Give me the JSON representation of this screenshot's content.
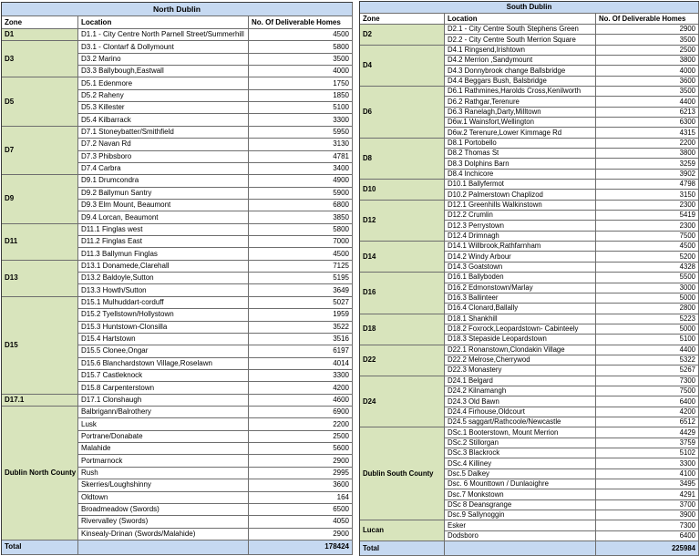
{
  "colors": {
    "title_bg": "#c6d9f1",
    "zone_bg": "#d8e4bc",
    "total_bg": "#c6d9f1",
    "grid_line": "#6e6e6e"
  },
  "north": {
    "title": "North Dublin",
    "headers": {
      "zone": "Zone",
      "location": "Location",
      "homes": "No. Of Deliverable Homes"
    },
    "zones": [
      {
        "zone": "D1",
        "rows": [
          {
            "location": "D1.1 - City Centre North Parnell Street/Summerhill",
            "homes": 4500
          }
        ]
      },
      {
        "zone": "D3",
        "rows": [
          {
            "location": "D3.1 - Clontarf & Dollymount",
            "homes": 5800
          },
          {
            "location": "D3.2 Marino",
            "homes": 3500
          },
          {
            "location": "D3.3 Ballybough,Eastwall",
            "homes": 4000
          }
        ]
      },
      {
        "zone": "D5",
        "rows": [
          {
            "location": "D5.1 Edenmore",
            "homes": 1750
          },
          {
            "location": "D5.2 Raheny",
            "homes": 1850
          },
          {
            "location": "D5.3 Killester",
            "homes": 5100
          },
          {
            "location": "D5.4 Kilbarrack",
            "homes": 3300
          }
        ]
      },
      {
        "zone": "D7",
        "rows": [
          {
            "location": "D7.1 Stoneybatter/Smithfield",
            "homes": 5950
          },
          {
            "location": "D7.2 Navan Rd",
            "homes": 3130
          },
          {
            "location": "D7.3 Phibsboro",
            "homes": 4781
          },
          {
            "location": "D7.4 Carbra",
            "homes": 3400
          }
        ]
      },
      {
        "zone": "D9",
        "rows": [
          {
            "location": "D9.1 Drumcondra",
            "homes": 4900
          },
          {
            "location": "D9.2 Ballymun Santry",
            "homes": 5900
          },
          {
            "location": "D9.3 Elm Mount, Beaumont",
            "homes": 6800
          },
          {
            "location": "D9.4 Lorcan, Beaumont",
            "homes": 3850
          }
        ]
      },
      {
        "zone": "D11",
        "rows": [
          {
            "location": "D11.1 Finglas west",
            "homes": 5800
          },
          {
            "location": "D11.2 Finglas East",
            "homes": 7000
          },
          {
            "location": "D11.3 Ballymun Finglas",
            "homes": 4500
          }
        ]
      },
      {
        "zone": "D13",
        "rows": [
          {
            "location": "D13.1 Donamede,Clarehall",
            "homes": 7125
          },
          {
            "location": "D13.2 Baldoyle,Sutton",
            "homes": 5195
          },
          {
            "location": "D13.3 Howth/Sutton",
            "homes": 3649
          }
        ]
      },
      {
        "zone": "D15",
        "rows": [
          {
            "location": "D15.1 Mulhuddart-corduff",
            "homes": 5027
          },
          {
            "location": "D15.2 Tyellstown/Hollystown",
            "homes": 1959
          },
          {
            "location": "D15.3 Huntstown-Clonsilla",
            "homes": 3522
          },
          {
            "location": "D15.4 Hartstown",
            "homes": 3516
          },
          {
            "location": "D15.5 Clonee,Ongar",
            "homes": 6197
          },
          {
            "location": "D15.6 Blanchardstown Village,Roselawn",
            "homes": 4014
          },
          {
            "location": "D15.7 Castleknock",
            "homes": 3300
          },
          {
            "location": "D15.8 Carpenterstown",
            "homes": 4200
          }
        ]
      },
      {
        "zone": "D17.1",
        "rows": [
          {
            "location": "D17.1 Clonshaugh",
            "homes": 4600
          }
        ]
      },
      {
        "zone": "Dublin North County",
        "rows": [
          {
            "location": "Balbrigann/Balrothery",
            "homes": 6900
          },
          {
            "location": "Lusk",
            "homes": 2200
          },
          {
            "location": "Portrane/Donabate",
            "homes": 2500
          },
          {
            "location": "Malahide",
            "homes": 5600
          },
          {
            "location": "Portmarnock",
            "homes": 2900
          },
          {
            "location": "Rush",
            "homes": 2995
          },
          {
            "location": "Skerries/Loughshinny",
            "homes": 3600
          },
          {
            "location": "Oldtown",
            "homes": 164
          },
          {
            "location": "Broadmeadow (Swords)",
            "homes": 6500
          },
          {
            "location": "Rivervalley (Swords)",
            "homes": 4050
          },
          {
            "location": "Kinsealy-Drinan (Swords/Malahide)",
            "homes": 2900
          }
        ]
      }
    ],
    "total": {
      "label": "Total",
      "homes": 178424
    }
  },
  "south": {
    "title": "South Dublin",
    "headers": {
      "zone": "Zone",
      "location": "Location",
      "homes": "No. Of Deliverable Homes"
    },
    "zones": [
      {
        "zone": "D2",
        "rows": [
          {
            "location": "D2.1 - City Centre South Stephens Green",
            "homes": 2900
          },
          {
            "location": "D2.2 - City Centre South Merrion Square",
            "homes": 3500
          }
        ]
      },
      {
        "zone": "D4",
        "rows": [
          {
            "location": "D4.1 Ringsend,Irishtown",
            "homes": 2500
          },
          {
            "location": "D4.2 Merrion ,Sandymount",
            "homes": 3800
          },
          {
            "location": "D4.3 Donnybrook change Ballsbridge",
            "homes": 4000
          },
          {
            "location": "D4.4 Beggars Bush, Balsbridge",
            "homes": 3600
          }
        ]
      },
      {
        "zone": "D6",
        "rows": [
          {
            "location": "D6.1 Rathmines,Harolds Cross,Kenilworth",
            "homes": 3500
          },
          {
            "location": "D6.2 Rathgar,Terenure",
            "homes": 4400
          },
          {
            "location": "D6.3 Ranelagh,Darty,Milltown",
            "homes": 6213
          },
          {
            "location": "D6w.1 Wainsfort,Wellington",
            "homes": 6300
          },
          {
            "location": "D6w.2 Terenure,Lower Kimmage Rd",
            "homes": 4315
          }
        ]
      },
      {
        "zone": "D8",
        "rows": [
          {
            "location": "D8.1 Portobello",
            "homes": 2200
          },
          {
            "location": "D8.2 Thomas St",
            "homes": 3800
          },
          {
            "location": "D8.3 Dolphins Barn",
            "homes": 3259
          },
          {
            "location": "D8.4 Inchicore",
            "homes": 3902
          }
        ]
      },
      {
        "zone": "D10",
        "rows": [
          {
            "location": "D10.1 Ballyfermot",
            "homes": 4798
          },
          {
            "location": "D10.2 Palmerstown Chaplizod",
            "homes": 3150
          }
        ]
      },
      {
        "zone": "D12",
        "rows": [
          {
            "location": "D12.1 Greenhills Walkinstown",
            "homes": 2300
          },
          {
            "location": "D12.2 Crumlin",
            "homes": 5419
          },
          {
            "location": "D12.3 Perrystown",
            "homes": 2300
          },
          {
            "location": "D12.4 Drimnagh",
            "homes": 7500
          }
        ]
      },
      {
        "zone": "D14",
        "rows": [
          {
            "location": "D14.1 Willbrook,Rathfarnham",
            "homes": 4500
          },
          {
            "location": "D14.2 Windy Arbour",
            "homes": 5200
          },
          {
            "location": "D14.3 Goatstown",
            "homes": 4328
          }
        ]
      },
      {
        "zone": "D16",
        "rows": [
          {
            "location": "D16.1 Ballyboden",
            "homes": 5500
          },
          {
            "location": "D16.2 Edmonstown/Marlay",
            "homes": 3000
          },
          {
            "location": "D16.3 Ballinteer",
            "homes": 5000
          },
          {
            "location": "D16.4 Clonard,Ballally",
            "homes": 2800
          }
        ]
      },
      {
        "zone": "D18",
        "rows": [
          {
            "location": "D18.1 Shankhill",
            "homes": 5223
          },
          {
            "location": "D18.2 Foxrock,Leopardstown- Cabinteely",
            "homes": 5000
          },
          {
            "location": "D18.3 Stepaside Leopardstown",
            "homes": 5100
          }
        ]
      },
      {
        "zone": "D22",
        "rows": [
          {
            "location": "D22.1 Ronanstown,Clondakin Village",
            "homes": 4400
          },
          {
            "location": "D22.2 Melrose,Cherrywod",
            "homes": 5322
          },
          {
            "location": "D22.3 Monastery",
            "homes": 5267
          }
        ]
      },
      {
        "zone": "D24",
        "rows": [
          {
            "location": "D24.1 Belgard",
            "homes": 7300
          },
          {
            "location": "D24.2 Kilnamangh",
            "homes": 7500
          },
          {
            "location": "D24.3 Old Bawn",
            "homes": 6400
          },
          {
            "location": "D24.4 Firhouse,Oldcourt",
            "homes": 4200
          },
          {
            "location": "D24.5 saggart/Rathcoole/Newcastle",
            "homes": 6512
          }
        ]
      },
      {
        "zone": "Dublin South County",
        "rows": [
          {
            "location": "DSc.1 Booterstown, Mount Merrion",
            "homes": 4429
          },
          {
            "location": "DSc.2 Stillorgan",
            "homes": 3759
          },
          {
            "location": "DSc.3 Blackrock",
            "homes": 5102
          },
          {
            "location": "DSc.4 Killiney",
            "homes": 3300
          },
          {
            "location": "Dsc.5 Dalkey",
            "homes": 4100
          },
          {
            "location": "Dsc. 6 Mounttown / Dunlaoighre",
            "homes": 3495
          },
          {
            "location": "Dsc.7 Monkstown",
            "homes": 4291
          },
          {
            "location": "DSc 8 Deansgrange",
            "homes": 3700
          },
          {
            "location": "Dsc.9 Sallynoggin",
            "homes": 3900
          }
        ]
      },
      {
        "zone": "Lucan",
        "rows": [
          {
            "location": "Esker",
            "homes": 7300
          },
          {
            "location": "Dodsboro",
            "homes": 6400
          }
        ]
      }
    ],
    "total": {
      "label": "Total",
      "homes": 225984
    }
  }
}
